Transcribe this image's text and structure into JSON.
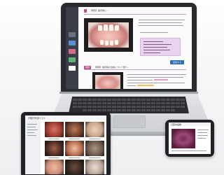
{
  "laptop": {
    "question_a_tag": "",
    "question_a_text": "【問題】歯周病に…",
    "question_b_tag": "問題",
    "question_b_text": "【問題】歯周病の治療について選べ…",
    "action_button": "回答する",
    "sidebar_icon_colors": [
      "#6b7280",
      "#5a8fd6",
      "#d46b8f",
      "#5fb27a",
      "#ffffff"
    ]
  },
  "tablet": {
    "title": "口腔内写真リスト",
    "tile_colors": [
      "#9c3b2e",
      "#6b3e2c",
      "#caa48a",
      "#4a2a22",
      "#b36a4a",
      "#6e5a4c",
      "#c98c76",
      "#2d1f1b",
      "#b8a69a"
    ]
  },
  "phone": {
    "title": "口腔内画像"
  },
  "colors": {
    "accent_pink": "#c04a8f",
    "accent_blue": "#2d6fb5",
    "device_dark": "#202226"
  }
}
